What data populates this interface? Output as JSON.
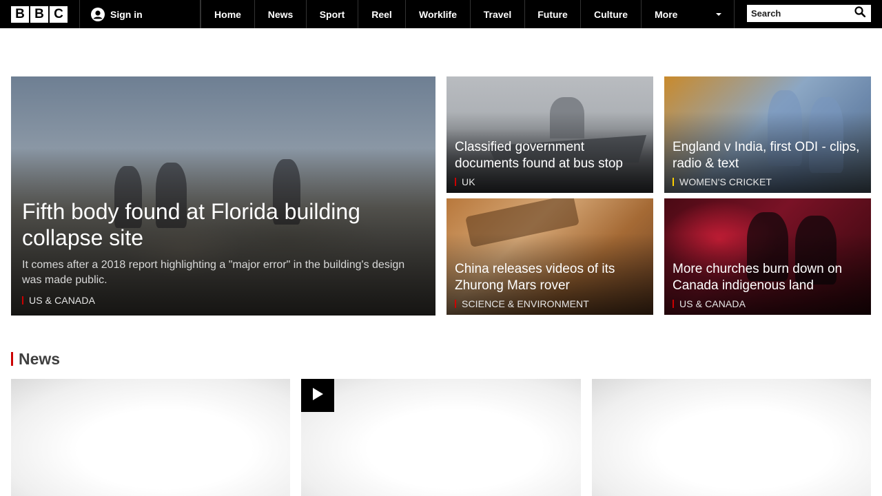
{
  "header": {
    "logo_letters": [
      "B",
      "B",
      "C"
    ],
    "signin_label": "Sign in",
    "nav": [
      {
        "label": "Home",
        "w": 79
      },
      {
        "label": "News",
        "w": 75
      },
      {
        "label": "Sport",
        "w": 75
      },
      {
        "label": "Reel",
        "w": 69
      },
      {
        "label": "Worklife",
        "w": 94
      },
      {
        "label": "Travel",
        "w": 79
      },
      {
        "label": "Future",
        "w": 81
      },
      {
        "label": "Culture",
        "w": 88
      }
    ],
    "more_label": "More",
    "search": {
      "placeholder": "Search"
    }
  },
  "hero": {
    "main": {
      "title": "Fifth body found at Florida building collapse site",
      "summary": "It comes after a 2018 report highlighting a \"major error\" in the building's design was made public.",
      "tag": "US & CANADA"
    },
    "cards": [
      {
        "title": "Classified government documents found at bus stop",
        "tag": "UK"
      },
      {
        "title": "England v India, first ODI - clips, radio & text",
        "tag": "WOMEN'S CRICKET"
      },
      {
        "title": "China releases videos of its Zhurong Mars rover",
        "tag": "SCIENCE & ENVIRONMENT"
      },
      {
        "title": "More churches burn down on Canada indigenous land",
        "tag": "US & CANADA"
      }
    ]
  },
  "news_section": {
    "heading": "News"
  },
  "colors": {
    "accent_red": "#cc0000",
    "cricket_yellow": "#ffd200",
    "topbar": "#000000"
  }
}
